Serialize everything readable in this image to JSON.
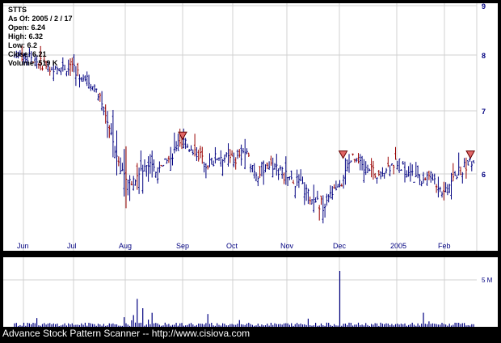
{
  "info": {
    "symbol": "STTS",
    "as_of": "As Of: 2005 / 2 / 17",
    "open": "Open: 6.24",
    "high": "High: 6.32",
    "low": "Low: 6.2",
    "close": "Close: 6.21",
    "volume": "Volume: 519 K"
  },
  "footer": "Advance Stock Pattern Scanner -- http://www.cisiova.com",
  "colors": {
    "background": "#000000",
    "panel": "#ffffff",
    "grid": "#d0d0d0",
    "bar": "#000080",
    "down_bar": "#990000",
    "marker_fill": "#e06666",
    "marker_stroke": "#660000",
    "axis_label": "#000080"
  },
  "chart_data": [
    {
      "type": "ohlc",
      "ylim": [
        5.3,
        9
      ],
      "y_ticks": [
        "6",
        "7",
        "8",
        "9"
      ],
      "x_ticks": [
        "Jun",
        "Jul",
        "Aug",
        "Sep",
        "Oct",
        "Nov",
        "Dec",
        "2005",
        "Feb"
      ],
      "grid": true,
      "close_points": [
        {
          "x": "Jun 1",
          "y": 8.0
        },
        {
          "x": "Jun 15",
          "y": 7.8
        },
        {
          "x": "Jul 1",
          "y": 7.75
        },
        {
          "x": "Jul 15",
          "y": 7.4
        },
        {
          "x": "Jul 22",
          "y": 6.8
        },
        {
          "x": "Jul 29",
          "y": 6.1
        },
        {
          "x": "Aug 5",
          "y": 5.9
        },
        {
          "x": "Aug 12",
          "y": 6.15
        },
        {
          "x": "Aug 19",
          "y": 6.0
        },
        {
          "x": "Aug 26",
          "y": 6.3
        },
        {
          "x": "Sep 2",
          "y": 6.5
        },
        {
          "x": "Sep 9",
          "y": 6.35
        },
        {
          "x": "Sep 16",
          "y": 6.15
        },
        {
          "x": "Sep 23",
          "y": 6.3
        },
        {
          "x": "Oct 1",
          "y": 6.2
        },
        {
          "x": "Oct 8",
          "y": 6.35
        },
        {
          "x": "Oct 15",
          "y": 6.0
        },
        {
          "x": "Oct 22",
          "y": 6.2
        },
        {
          "x": "Nov 1",
          "y": 5.95
        },
        {
          "x": "Nov 8",
          "y": 5.85
        },
        {
          "x": "Nov 15",
          "y": 5.6
        },
        {
          "x": "Nov 22",
          "y": 5.5
        },
        {
          "x": "Dec 1",
          "y": 5.8
        },
        {
          "x": "Dec 8",
          "y": 6.25
        },
        {
          "x": "Dec 15",
          "y": 6.05
        },
        {
          "x": "Dec 22",
          "y": 6.0
        },
        {
          "x": "Jan 1",
          "y": 6.2
        },
        {
          "x": "Jan 8",
          "y": 6.0
        },
        {
          "x": "Jan 15",
          "y": 5.9
        },
        {
          "x": "Jan 22",
          "y": 6.0
        },
        {
          "x": "Feb 1",
          "y": 5.7
        },
        {
          "x": "Feb 8",
          "y": 6.0
        },
        {
          "x": "Feb 17",
          "y": 6.21
        }
      ],
      "triangle_markers": [
        {
          "x": "Sep 1",
          "y": 6.6
        },
        {
          "x": "Dec 3",
          "y": 6.3
        },
        {
          "x": "Feb 16",
          "y": 6.3
        }
      ]
    },
    {
      "type": "bar",
      "label": "5 M",
      "description": "daily volume",
      "spikes": [
        {
          "x": "Aug 7",
          "value": 3.0
        },
        {
          "x": "Aug 10",
          "value": 2.0
        },
        {
          "x": "Dec 1",
          "value": 6.0
        }
      ],
      "typical_value": 0.3
    }
  ]
}
